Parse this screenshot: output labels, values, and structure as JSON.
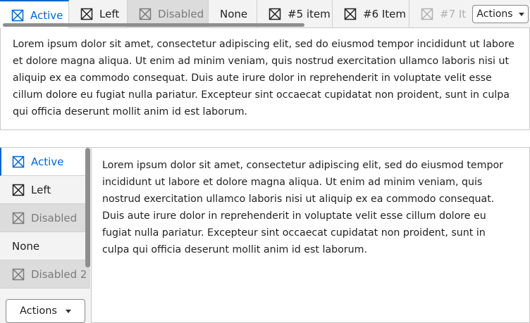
{
  "top_tabs": {
    "items": [
      {
        "label": "Active",
        "icon": "x-box-icon",
        "state": "active"
      },
      {
        "label": "Left",
        "icon": "x-box-icon",
        "state": "normal"
      },
      {
        "label": "Disabled",
        "icon": "x-box-icon",
        "state": "disabled"
      },
      {
        "label": "None",
        "icon": "",
        "state": "normal"
      },
      {
        "label": "#5 item",
        "icon": "x-box-icon",
        "state": "normal"
      },
      {
        "label": "#6 Item",
        "icon": "x-box-icon",
        "state": "normal"
      },
      {
        "label": "#7 It",
        "icon": "x-box-icon",
        "state": "faded"
      }
    ],
    "actions_label": "Actions",
    "panel_text": "Lorem ipsum dolor sit amet, consectetur adipiscing elit, sed do eiusmod tempor incididunt ut labore et dolore magna aliqua. Ut enim ad minim veniam, quis nostrud exercitation ullamco laboris nisi ut aliquip ex ea commodo consequat. Duis aute irure dolor in reprehenderit in voluptate velit esse cillum dolore eu fugiat nulla pariatur. Excepteur sint occaecat cupidatat non proident, sunt in culpa qui officia deserunt mollit anim id est laborum."
  },
  "side_tabs": {
    "items": [
      {
        "label": "Active",
        "icon": "x-box-icon",
        "state": "active"
      },
      {
        "label": "Left",
        "icon": "x-box-icon",
        "state": "normal"
      },
      {
        "label": "Disabled",
        "icon": "x-box-icon",
        "state": "disabled"
      },
      {
        "label": "None",
        "icon": "",
        "state": "normal"
      },
      {
        "label": "Disabled 2",
        "icon": "x-box-icon",
        "state": "disabled"
      }
    ],
    "actions_label": "Actions",
    "panel_text": "Lorem ipsum dolor sit amet, consectetur adipiscing elit, sed do eiusmod tempor incididunt ut labore et dolore magna aliqua. Ut enim ad minim veniam, quis nostrud exercitation ullamco laboris nisi ut aliquip ex ea commodo consequat. Duis aute irure dolor in reprehenderit in voluptate velit esse cillum dolore eu fugiat nulla pariatur. Excepteur sint occaecat cupidatat non proident, sunt in culpa qui officia deserunt mollit anim id est laborum."
  },
  "colors": {
    "accent": "#0066cc",
    "tab_bar": "#f3f3f3",
    "disabled_tab": "#dcdcdc",
    "border": "#c9c9c9",
    "scrollbar": "#8e8e8e"
  }
}
